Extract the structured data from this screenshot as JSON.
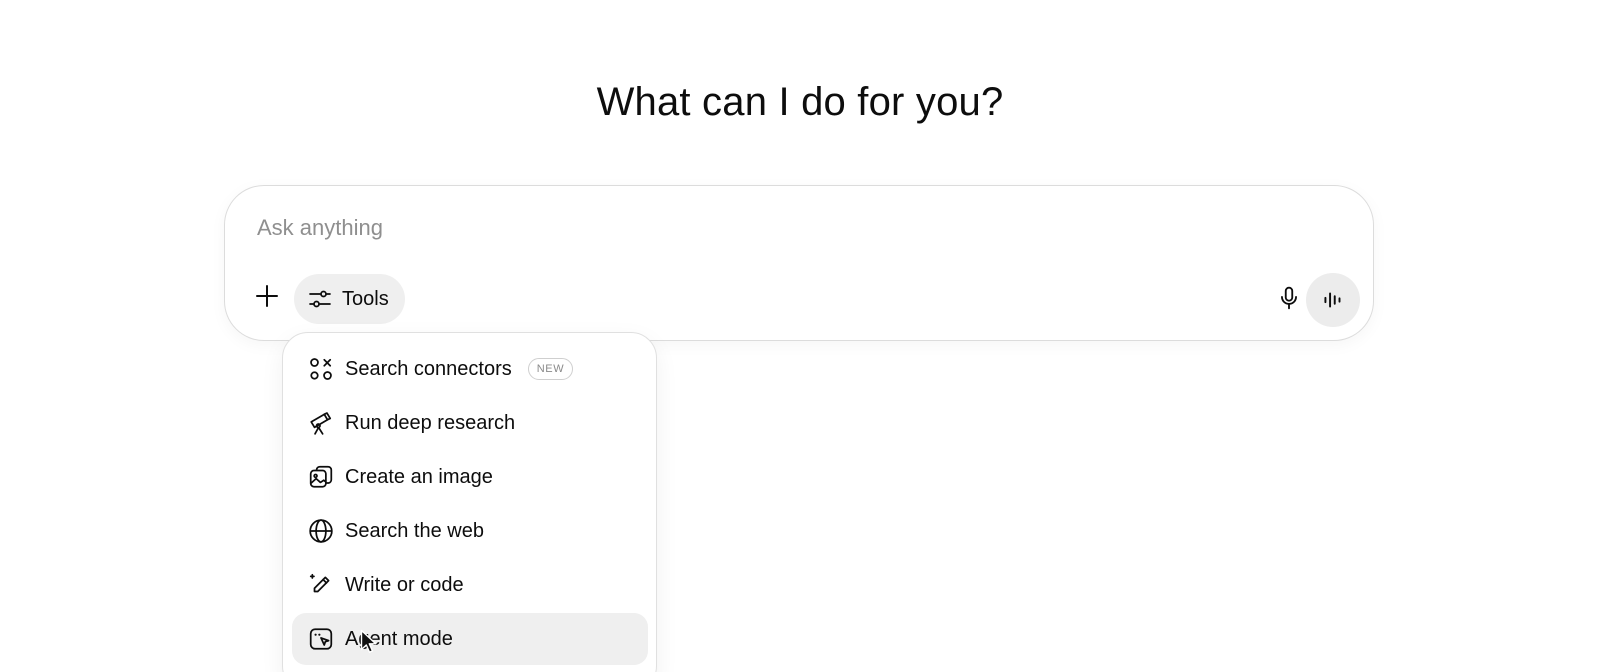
{
  "headline": "What can I do for you?",
  "composer": {
    "placeholder": "Ask anything",
    "value": "",
    "tools_label": "Tools",
    "icons": {
      "attach": "plus-icon",
      "tools": "sliders-icon",
      "mic": "microphone-icon",
      "voice": "voice-waveform-icon"
    }
  },
  "tools_menu": {
    "items": [
      {
        "label": "Search connectors",
        "icon": "connectors-icon",
        "badge": "NEW"
      },
      {
        "label": "Run deep research",
        "icon": "telescope-icon"
      },
      {
        "label": "Create an image",
        "icon": "image-icon"
      },
      {
        "label": "Search the web",
        "icon": "globe-icon"
      },
      {
        "label": "Write or code",
        "icon": "pencil-sparkle-icon"
      },
      {
        "label": "Agent mode",
        "icon": "agent-cursor-icon",
        "highlighted": true
      }
    ]
  },
  "colors": {
    "text": "#0d0d0d",
    "placeholder": "#8f8f8f",
    "pill_background": "#efefef",
    "border": "#dcdcdc"
  }
}
